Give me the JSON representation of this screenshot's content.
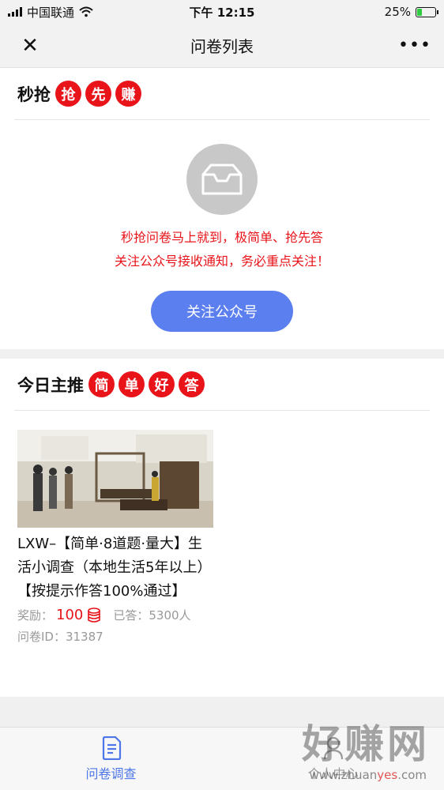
{
  "status_bar": {
    "carrier": "中国联通",
    "time": "下午 12:15",
    "battery": "25%",
    "battery_level": 0.25
  },
  "nav": {
    "title": "问卷列表",
    "close_icon": "close-icon",
    "more_icon": "more-icon"
  },
  "flash_section": {
    "title": "秒抢",
    "badges": [
      "抢",
      "先",
      "赚"
    ],
    "empty_line1": "秒抢问卷马上就到，极简单、抢先答",
    "empty_line2": "关注公众号接收通知，务必重点关注！",
    "follow_button": "关注公众号"
  },
  "featured_section": {
    "title": "今日主推",
    "badges": [
      "简",
      "单",
      "好",
      "答"
    ],
    "card": {
      "title": "LXW–【简单·8道题·量大】生活小调查（本地生活5年以上）【按提示作答100%通过】",
      "reward_label": "奖励：",
      "reward_value": "100",
      "answered": "已答：5300人",
      "survey_id": "问卷ID：31387"
    }
  },
  "tab_bar": {
    "tabs": [
      {
        "label": "问卷调查",
        "icon": "document-icon",
        "active": true
      },
      {
        "label": "个人中心",
        "icon": "user-icon",
        "active": false
      }
    ]
  },
  "watermark": {
    "text": "好赚网",
    "url_prefix": "www.zhuan",
    "url_highlight": "yes",
    "url_suffix": ".com"
  },
  "colors": {
    "accent_red": "#e8141a",
    "button_blue": "#5b7fee",
    "tab_active": "#4d76e8"
  }
}
